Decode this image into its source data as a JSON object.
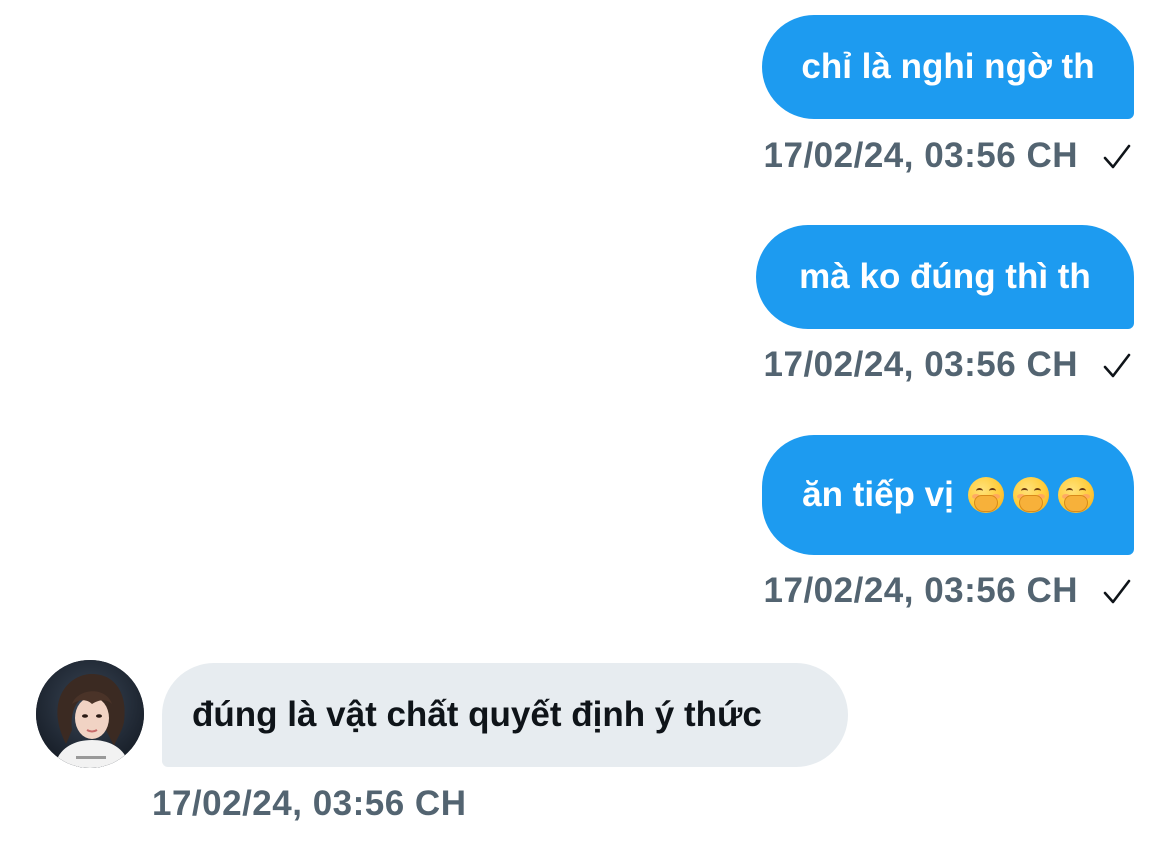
{
  "conversation": {
    "messages": [
      {
        "direction": "outgoing",
        "text": "chỉ là nghi ngờ th",
        "timestamp": "17/02/24, 03:56 CH",
        "status_icon": "sent-check-icon"
      },
      {
        "direction": "outgoing",
        "text": "mà ko đúng thì th",
        "timestamp": "17/02/24, 03:56 CH",
        "status_icon": "sent-check-icon"
      },
      {
        "direction": "outgoing",
        "text": "ăn tiếp vị",
        "emojis": [
          "hand-over-mouth-emoji",
          "hand-over-mouth-emoji",
          "hand-over-mouth-emoji"
        ],
        "timestamp": "17/02/24, 03:56 CH",
        "status_icon": "sent-check-icon"
      },
      {
        "direction": "incoming",
        "text": "đúng là vật chất quyết định ý thức",
        "timestamp": "17/02/24, 03:56 CH",
        "avatar": "user-avatar"
      }
    ]
  },
  "colors": {
    "outgoing_bubble": "#1d9bf0",
    "incoming_bubble": "#e7ecf0",
    "timestamp_text": "#536471",
    "outgoing_text": "#ffffff",
    "incoming_text": "#0f1419"
  }
}
